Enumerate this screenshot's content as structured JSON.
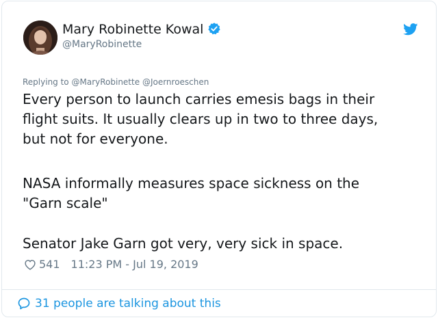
{
  "tweet": {
    "author": {
      "display_name": "Mary Robinette Kowal",
      "handle": "@MaryRobinette",
      "verified_icon": "verified-badge-icon",
      "avatar": "author-avatar"
    },
    "platform_icon": "twitter-bird-icon",
    "reply_to": {
      "prefix": "Replying to",
      "mentions": [
        "@MaryRobinette",
        "@Joernroeschen"
      ]
    },
    "paragraphs": [
      [
        "Every person to launch carries emesis bags in their",
        "flight suits. It usually clears up in two to three days,",
        "but not for everyone."
      ],
      [
        "NASA informally measures space sickness on the",
        "\"Garn scale\""
      ],
      [
        "Senator Jake Garn got very, very sick in space."
      ]
    ],
    "likes": "541",
    "timestamp": "11:23 PM - Jul 19, 2019",
    "talking": "31 people are talking about this"
  },
  "colors": {
    "link": "#1b95e0",
    "twitter_blue": "#1da1f2",
    "secondary_text": "#657786",
    "border": "#e1e8ed"
  }
}
